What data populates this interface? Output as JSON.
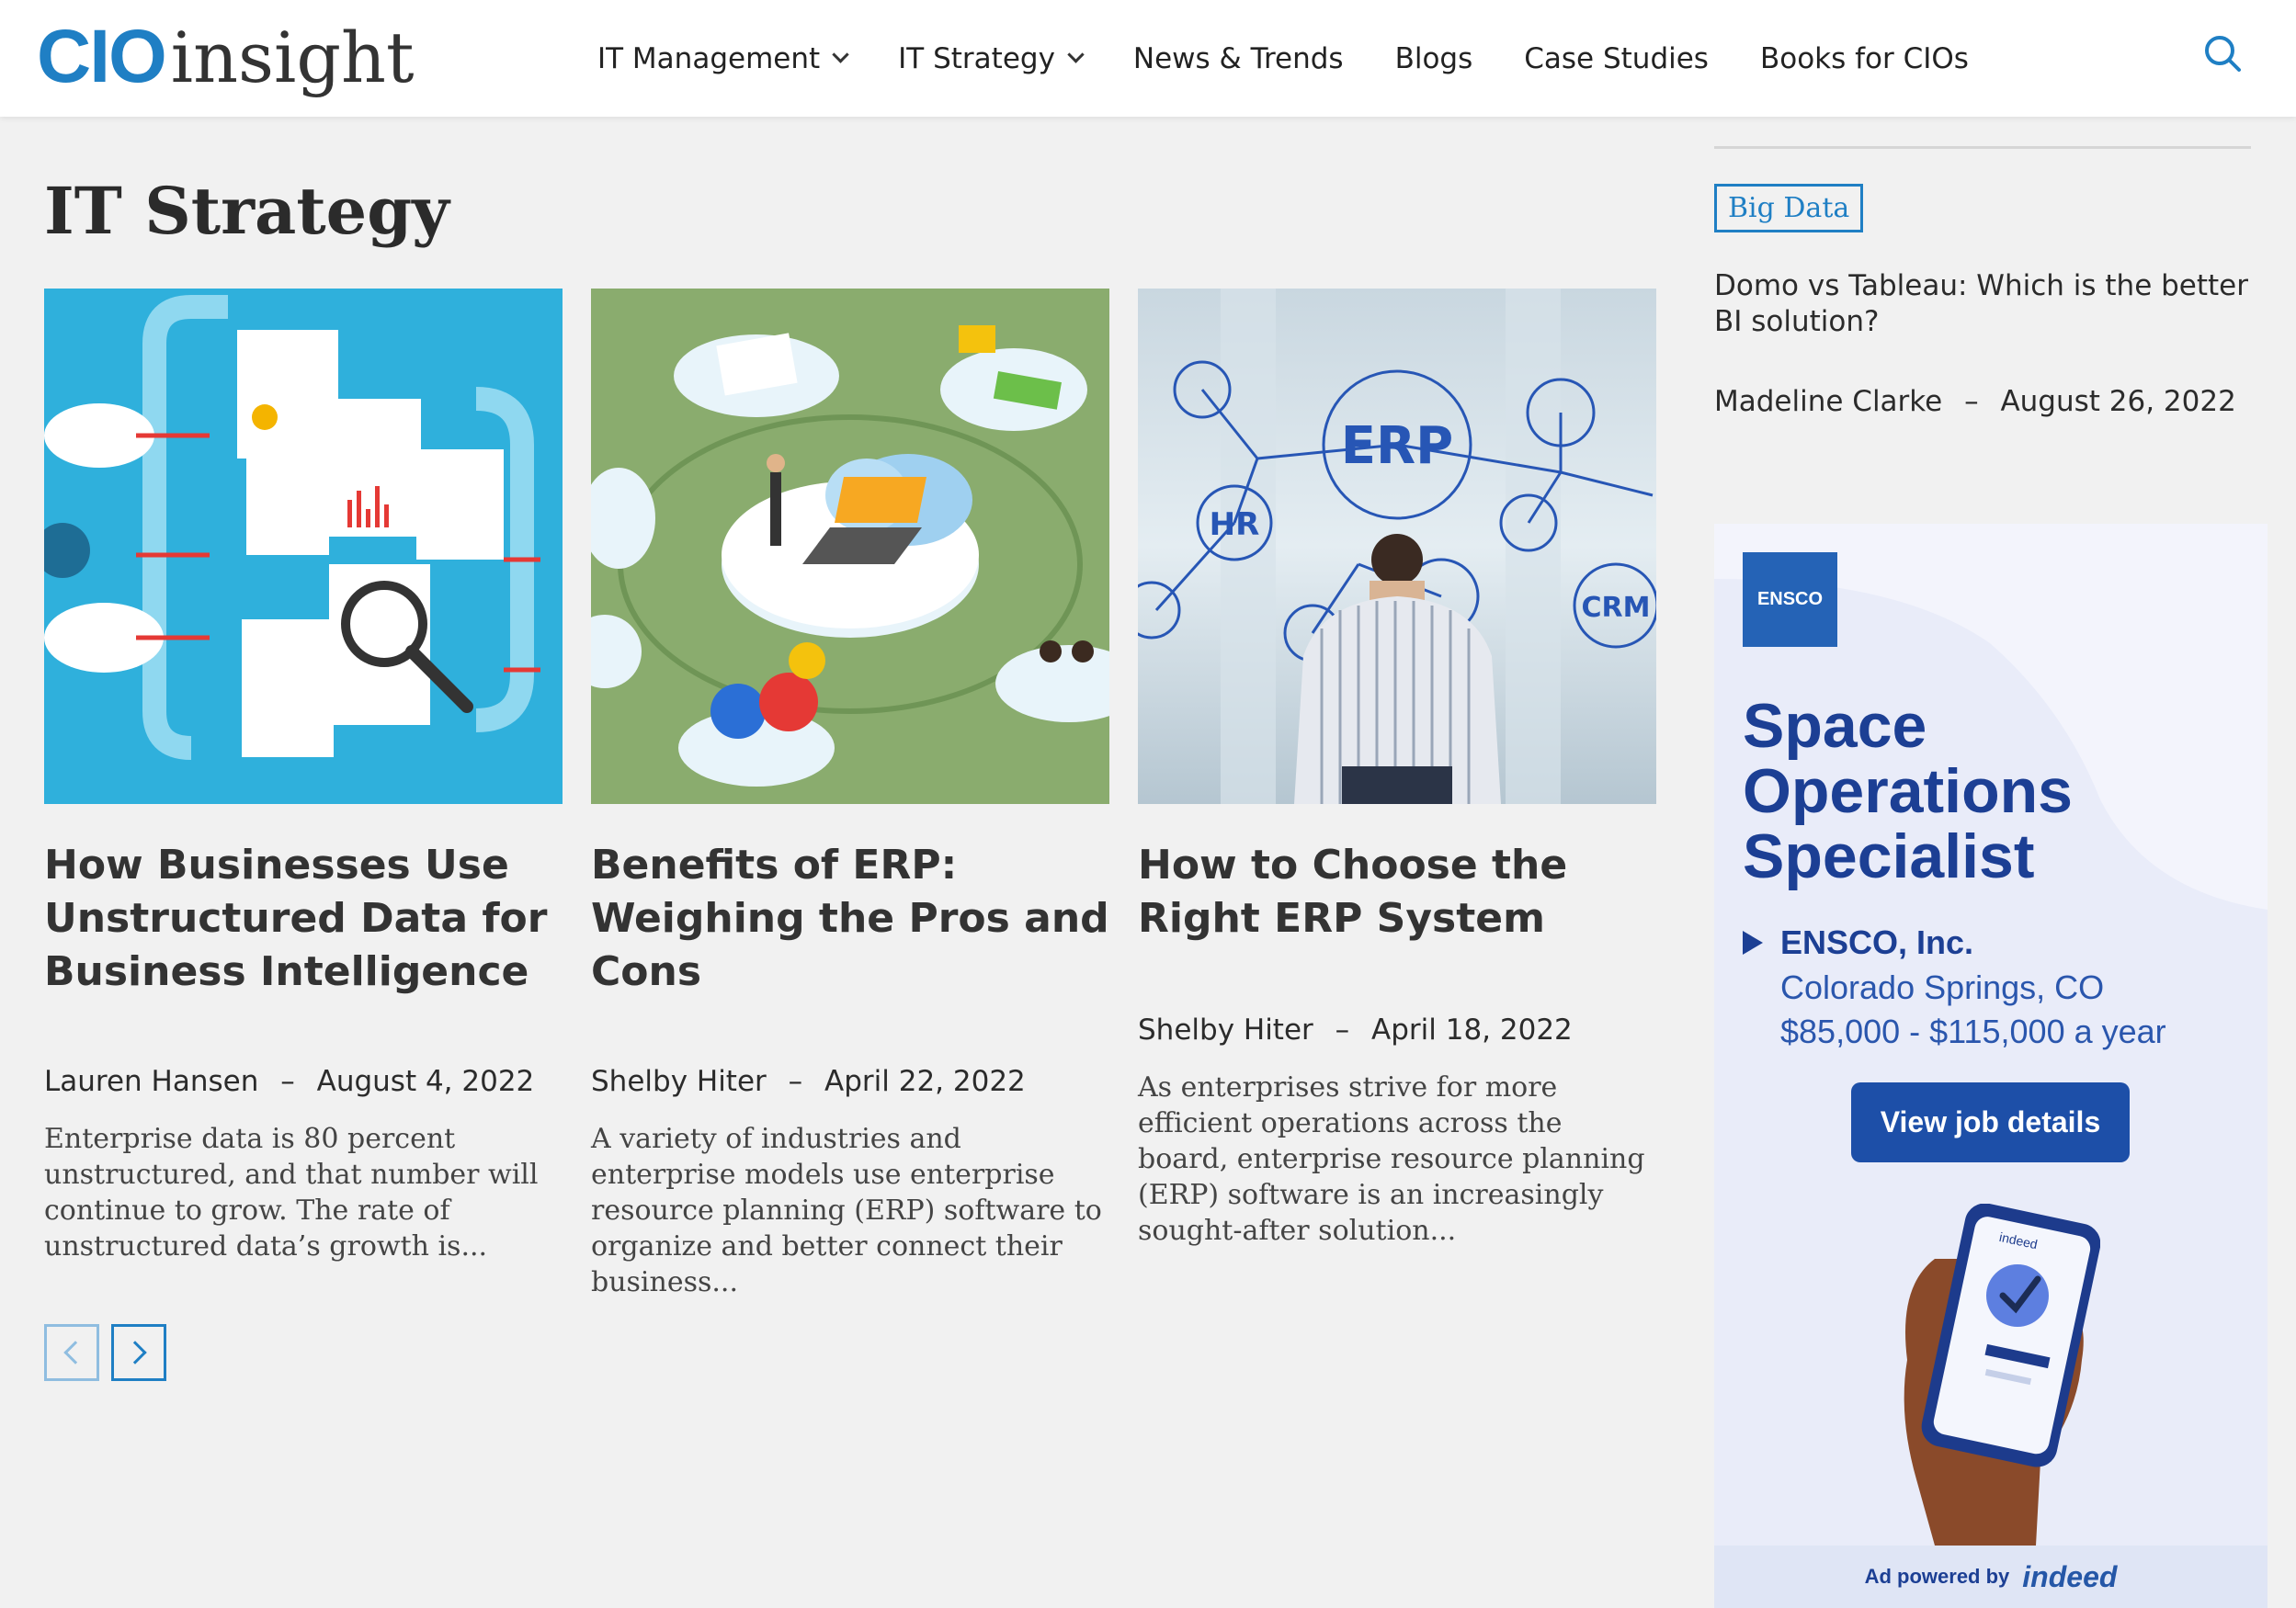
{
  "brand": {
    "logo_cio": "CIO",
    "logo_insight": "insight",
    "accent": "#1f7fc4"
  },
  "nav": {
    "items": [
      {
        "label": "IT Management",
        "dropdown": true
      },
      {
        "label": "IT Strategy",
        "dropdown": true
      },
      {
        "label": "News & Trends",
        "dropdown": false
      },
      {
        "label": "Blogs",
        "dropdown": false
      },
      {
        "label": "Case Studies",
        "dropdown": false
      },
      {
        "label": "Books for CIOs",
        "dropdown": false
      }
    ],
    "search_icon": "search-icon"
  },
  "page": {
    "title": "IT Strategy"
  },
  "cards": [
    {
      "title": "How Businesses Use Unstructured Data for Business Intelligence",
      "author": "Lauren Hansen",
      "sep": "–",
      "date": "August 4, 2022",
      "excerpt": "Enterprise data is 80 percent unstructured, and that number will continue to grow. The rate of unstructured data’s growth is...",
      "image": "unstructured-data-illustration"
    },
    {
      "title": "Benefits of ERP: Weighing the Pros and Cons",
      "author": "Shelby Hiter",
      "sep": "–",
      "date": "April 22, 2022",
      "excerpt": "A variety of industries and enterprise models use enterprise resource planning (ERP) software to organize and better connect their business...",
      "image": "erp-isometric-illustration"
    },
    {
      "title": "How to Choose the Right ERP System",
      "author": "Shelby Hiter",
      "sep": "–",
      "date": "April 18, 2022",
      "excerpt": "As enterprises strive for more efficient operations across the board, enterprise resource planning (ERP) software is an increasingly sought-after solution...",
      "image": "erp-network-photo"
    }
  ],
  "pager": {
    "prev_icon": "chevron-left-icon",
    "next_icon": "chevron-right-icon"
  },
  "sidebar": {
    "tag": "Big Data",
    "title": "Domo vs Tableau: Which is the better BI solution?",
    "author": "Madeline Clarke",
    "sep": "–",
    "date": "August 26, 2022"
  },
  "ad": {
    "logo_text": "ENSCO",
    "headline": "Space Operations Specialist",
    "company": "ENSCO, Inc.",
    "location": "Colorado Springs, CO",
    "pay": "$85,000 - $115,000 a year",
    "button": "View job details",
    "phone_label": "indeed",
    "powered_by": "Ad powered by",
    "powered_brand": "indeed",
    "colors": {
      "navy": "#1c3f94",
      "button": "#1d4fa8",
      "bg": "#e9ecf9"
    }
  }
}
